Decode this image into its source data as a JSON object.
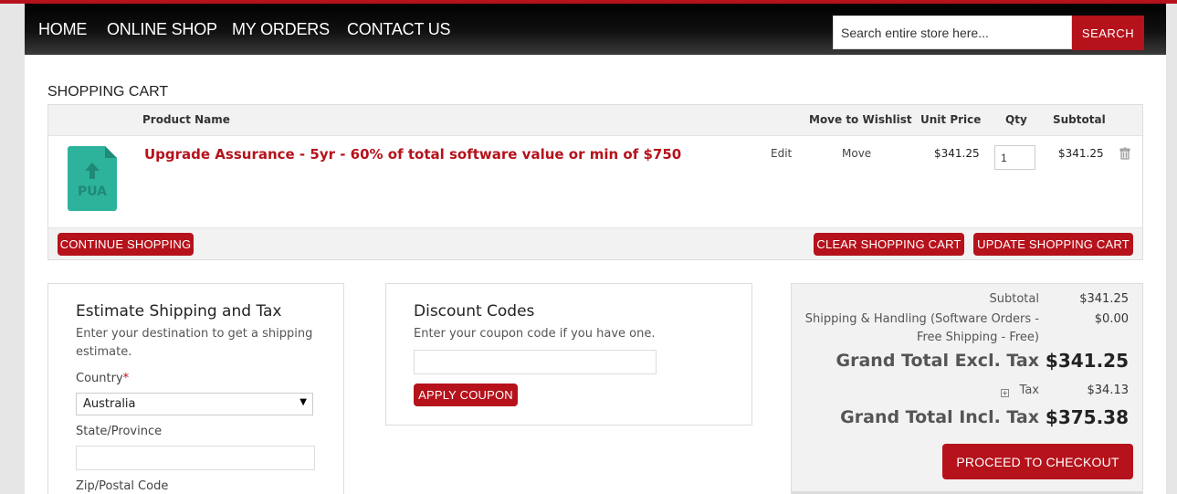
{
  "nav": {
    "items": [
      {
        "label": "HOME"
      },
      {
        "label": "ONLINE SHOP"
      },
      {
        "label": "MY ORDERS"
      },
      {
        "label": "CONTACT US"
      }
    ],
    "search_placeholder": "Search entire store here...",
    "search_button": "SEARCH"
  },
  "cart": {
    "title": "SHOPPING CART",
    "headers": {
      "product_name": "Product Name",
      "move_to_wishlist": "Move to Wishlist",
      "unit_price": "Unit Price",
      "qty": "Qty",
      "subtotal": "Subtotal"
    },
    "item": {
      "thumbnail_text": "PUA",
      "name": "Upgrade Assurance - 5yr - 60% of total software value or min of $750",
      "edit": "Edit",
      "move": "Move",
      "unit_price": "$341.25",
      "qty": "1",
      "subtotal": "$341.25"
    },
    "buttons": {
      "continue": "CONTINUE SHOPPING",
      "clear": "CLEAR SHOPPING CART",
      "update": "UPDATE SHOPPING CART"
    }
  },
  "shipping": {
    "title": "Estimate Shipping and Tax",
    "description": "Enter your destination to get a shipping estimate.",
    "country_label": "Country",
    "required_mark": "*",
    "country_value": "Australia",
    "state_label": "State/Province",
    "zip_label": "Zip/Postal Code"
  },
  "discount": {
    "title": "Discount Codes",
    "description": "Enter your coupon code if you have one.",
    "apply_button": "APPLY COUPON"
  },
  "totals": {
    "subtotal_label": "Subtotal",
    "subtotal_value": "$341.25",
    "shipping_label_line1": "Shipping & Handling (Software Orders -",
    "shipping_label_line2": "Free Shipping - Free)",
    "shipping_value": "$0.00",
    "grand_excl_label": "Grand Total Excl. Tax",
    "grand_excl_value": "$341.25",
    "tax_toggle": "+",
    "tax_label": "Tax",
    "tax_value": "$34.13",
    "grand_incl_label": "Grand Total Incl. Tax",
    "grand_incl_value": "$375.38",
    "checkout_button": "PROCEED TO CHECKOUT"
  },
  "colors": {
    "accent": "#b5121b",
    "thumbnail": "#2db39b"
  },
  "icons": [
    "upload-arrow-icon",
    "trash-icon",
    "chevron-down-icon",
    "expand-plus-icon"
  ]
}
